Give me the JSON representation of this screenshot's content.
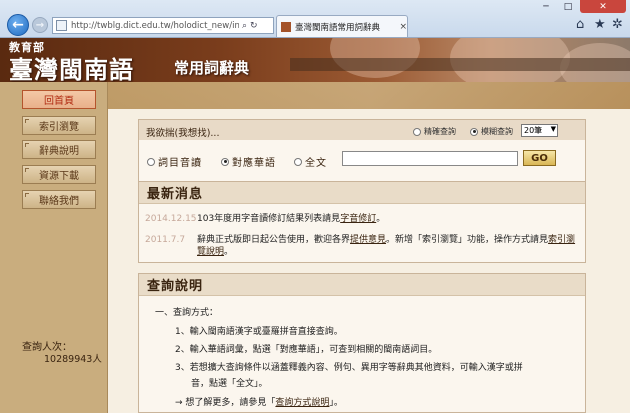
{
  "browser": {
    "url": "http://twblg.dict.edu.tw/holodict_new/index.ht",
    "tab_title": "臺灣閩南語常用詞辭典",
    "tab_close": "×",
    "back_glyph": "←",
    "forward_glyph": "→",
    "search_glyph": "⌕",
    "refresh_glyph": "↻",
    "win_min": "─",
    "win_max": "□",
    "win_close": "✕",
    "home_glyph": "⌂",
    "star_glyph": "★",
    "gear_glyph": "✲"
  },
  "header": {
    "ministry": "教育部",
    "title": "臺灣閩南語",
    "subtitle": "常用詞辭典"
  },
  "sidebar": {
    "items": [
      {
        "label": "回首頁",
        "active": true
      },
      {
        "label": "索引瀏覽",
        "active": false
      },
      {
        "label": "辭典說明",
        "active": false
      },
      {
        "label": "資源下載",
        "active": false
      },
      {
        "label": "聯絡我們",
        "active": false
      }
    ],
    "visitor_label": "查詢人次：",
    "visitor_count": "10289943人"
  },
  "search": {
    "label": "我欲揣(我想找)...",
    "mode_options": [
      "精確查詢",
      "模糊查詢"
    ],
    "mode_selected": "模糊查詢",
    "page_size": "20筆",
    "field_options": [
      "詞目音讀",
      "對應華語",
      "全文"
    ],
    "field_selected": "對應華語",
    "query_value": "",
    "go_label": "GO"
  },
  "news": {
    "title": "最新消息",
    "items": [
      {
        "date": "2014.12.15",
        "text_pre": "103年度用字音讀修訂結果列表請見",
        "link": "字音修訂",
        "text_post": "。"
      },
      {
        "date": "2011.7.7",
        "text_pre": "辭典正式版即日起公告使用，歡迎各界",
        "link": "提供意見",
        "text_mid": "。新增「索引瀏覽」功能，操作方式請見",
        "link2": "索引瀏覽說明",
        "text_post": "。"
      }
    ]
  },
  "help": {
    "title": "查詢說明",
    "heading": "一、查詢方式：",
    "lines": [
      "1、輸入閩南語漢字或臺羅拼音直接查詢。",
      "2、輸入華語詞彙，點選「對應華語」，可查到相關的閩南語詞目。",
      "3、若想擴大查詢條件以涵蓋釋義內容、例句、異用字等辭典其他資料，可輸入漢字或拼",
      "音，點選「全文」。"
    ],
    "more_pre": "→  想了解更多，請參見「",
    "more_link": "查詢方式說明",
    "more_post": "」。"
  },
  "colors": {
    "accent": "#b02a10",
    "sidebar": "#c9ad7e",
    "banner": "#7a3d1c"
  }
}
